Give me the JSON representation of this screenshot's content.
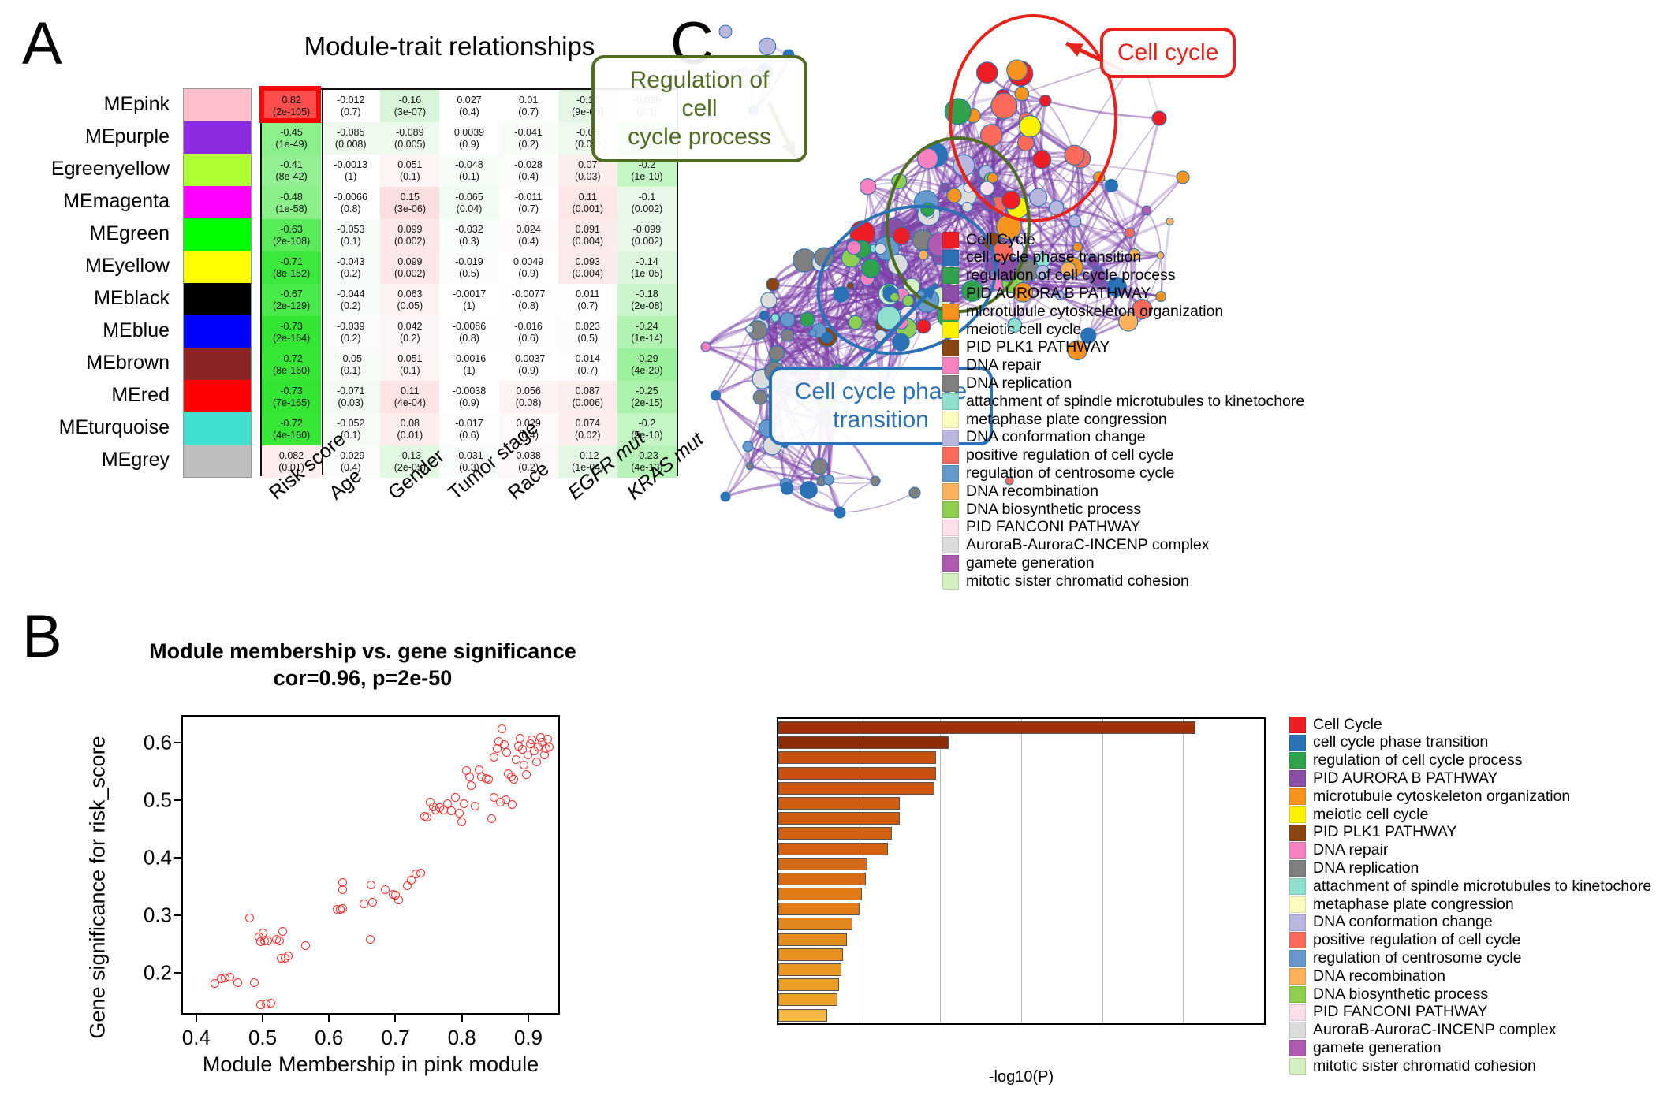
{
  "panels": {
    "a": "A",
    "b": "B",
    "c": "C"
  },
  "heatmap": {
    "title": "Module-trait relationships",
    "row_labels": [
      "MEpink",
      "MEpurple",
      "Egreenyellow",
      "MEmagenta",
      "MEgreen",
      "MEyellow",
      "MEblack",
      "MEblue",
      "MEbrown",
      "MEred",
      "MEturquoise",
      "MEgrey"
    ],
    "row_colors": [
      "#ffc0cb",
      "#8a2be2",
      "#adff2f",
      "#ff00ff",
      "#00ff00",
      "#ffff00",
      "#000000",
      "#0000ff",
      "#8b2525",
      "#ff0000",
      "#40e0d0",
      "#bebebe"
    ],
    "col_labels": [
      "Risk score",
      "Age",
      "Gender",
      "Tumor stage",
      "Race",
      "EGFR mut",
      "KRAS mut"
    ],
    "col_italic": [
      false,
      false,
      false,
      false,
      false,
      true,
      true
    ],
    "highlight_cell": {
      "row": 0,
      "col": 0,
      "color": "#ff0000"
    },
    "cells": [
      [
        {
          "v": "0.82",
          "p": "(2e-105)",
          "bg": "#ff4c4c"
        },
        {
          "v": "-0.012",
          "p": "(0.7)",
          "bg": "#ffffff"
        },
        {
          "v": "-0.16",
          "p": "(3e-07)",
          "bg": "#d9f5d9"
        },
        {
          "v": "0.027",
          "p": "(0.4)",
          "bg": "#ffffff"
        },
        {
          "v": "0.01",
          "p": "(0.7)",
          "bg": "#ffffff"
        },
        {
          "v": "-0.12",
          "p": "(9e-05)",
          "bg": "#e4f7e4"
        },
        {
          "v": "-0.036",
          "p": "(0.3)",
          "bg": "#ffffff"
        }
      ],
      [
        {
          "v": "-0.45",
          "p": "(1e-49)",
          "bg": "#8cf08c"
        },
        {
          "v": "-0.085",
          "p": "(0.008)",
          "bg": "#eefaee"
        },
        {
          "v": "-0.089",
          "p": "(0.005)",
          "bg": "#edfaed"
        },
        {
          "v": "0.0039",
          "p": "(0.9)",
          "bg": "#ffffff"
        },
        {
          "v": "-0.041",
          "p": "(0.2)",
          "bg": "#f7fcf7"
        },
        {
          "v": "-0.08",
          "p": "(0.01)",
          "bg": "#eefaee"
        },
        {
          "v": "-0.29",
          "p": "(2e-20)",
          "bg": "#9cf29c"
        }
      ],
      [
        {
          "v": "-0.41",
          "p": "(8e-42)",
          "bg": "#93f193"
        },
        {
          "v": "-0.0013",
          "p": "(1)",
          "bg": "#ffffff"
        },
        {
          "v": "0.051",
          "p": "(0.1)",
          "bg": "#fdf4f4"
        },
        {
          "v": "-0.048",
          "p": "(0.1)",
          "bg": "#f6fcf6"
        },
        {
          "v": "-0.028",
          "p": "(0.4)",
          "bg": "#fafdfa"
        },
        {
          "v": "0.07",
          "p": "(0.03)",
          "bg": "#fdeeee"
        },
        {
          "v": "-0.2",
          "p": "(1e-10)",
          "bg": "#c4f5c4"
        }
      ],
      [
        {
          "v": "-0.48",
          "p": "(1e-58)",
          "bg": "#8af08a"
        },
        {
          "v": "-0.0066",
          "p": "(0.8)",
          "bg": "#ffffff"
        },
        {
          "v": "0.15",
          "p": "(3e-06)",
          "bg": "#fbdede"
        },
        {
          "v": "-0.065",
          "p": "(0.04)",
          "bg": "#f2fbf2"
        },
        {
          "v": "-0.011",
          "p": "(0.7)",
          "bg": "#fdfefd"
        },
        {
          "v": "0.11",
          "p": "(0.001)",
          "bg": "#fce6e6"
        },
        {
          "v": "-0.1",
          "p": "(0.002)",
          "bg": "#e9f9e9"
        }
      ],
      [
        {
          "v": "-0.63",
          "p": "(2e-108)",
          "bg": "#5aeb5a"
        },
        {
          "v": "-0.053",
          "p": "(0.1)",
          "bg": "#f6fcf6"
        },
        {
          "v": "0.099",
          "p": "(0.002)",
          "bg": "#fce8e8"
        },
        {
          "v": "-0.032",
          "p": "(0.3)",
          "bg": "#f9fdf9"
        },
        {
          "v": "0.024",
          "p": "(0.4)",
          "bg": "#fefafa"
        },
        {
          "v": "0.091",
          "p": "(0.004)",
          "bg": "#fcebeb"
        },
        {
          "v": "-0.099",
          "p": "(0.002)",
          "bg": "#e9f9e9"
        }
      ],
      [
        {
          "v": "-0.71",
          "p": "(8e-152)",
          "bg": "#3ce83c"
        },
        {
          "v": "-0.043",
          "p": "(0.2)",
          "bg": "#f8fcf8"
        },
        {
          "v": "0.099",
          "p": "(0.002)",
          "bg": "#fce8e8"
        },
        {
          "v": "-0.019",
          "p": "(0.5)",
          "bg": "#fbfdfb"
        },
        {
          "v": "0.0049",
          "p": "(0.9)",
          "bg": "#ffffff"
        },
        {
          "v": "0.093",
          "p": "(0.004)",
          "bg": "#fcebeb"
        },
        {
          "v": "-0.14",
          "p": "(1e-05)",
          "bg": "#ddf7dd"
        }
      ],
      [
        {
          "v": "-0.67",
          "p": "(2e-129)",
          "bg": "#4aea4a"
        },
        {
          "v": "-0.044",
          "p": "(0.2)",
          "bg": "#f8fcf8"
        },
        {
          "v": "0.063",
          "p": "(0.05)",
          "bg": "#fdf1f1"
        },
        {
          "v": "-0.0017",
          "p": "(1)",
          "bg": "#ffffff"
        },
        {
          "v": "-0.0077",
          "p": "(0.8)",
          "bg": "#fefefe"
        },
        {
          "v": "0.011",
          "p": "(0.7)",
          "bg": "#fefdfd"
        },
        {
          "v": "-0.18",
          "p": "(2e-08)",
          "bg": "#cdf5cd"
        }
      ],
      [
        {
          "v": "-0.73",
          "p": "(2e-164)",
          "bg": "#33e633"
        },
        {
          "v": "-0.039",
          "p": "(0.2)",
          "bg": "#f9fcf9"
        },
        {
          "v": "0.042",
          "p": "(0.2)",
          "bg": "#fdf6f6"
        },
        {
          "v": "-0.0086",
          "p": "(0.8)",
          "bg": "#fefefe"
        },
        {
          "v": "-0.016",
          "p": "(0.6)",
          "bg": "#fcfdfc"
        },
        {
          "v": "0.023",
          "p": "(0.5)",
          "bg": "#fefbfb"
        },
        {
          "v": "-0.24",
          "p": "(1e-14)",
          "bg": "#b2f3b2"
        }
      ],
      [
        {
          "v": "-0.72",
          "p": "(8e-160)",
          "bg": "#36e736"
        },
        {
          "v": "-0.05",
          "p": "(0.1)",
          "bg": "#f7fcf7"
        },
        {
          "v": "0.051",
          "p": "(0.1)",
          "bg": "#fdf4f4"
        },
        {
          "v": "-0.0016",
          "p": "(1)",
          "bg": "#ffffff"
        },
        {
          "v": "-0.0037",
          "p": "(0.9)",
          "bg": "#ffffff"
        },
        {
          "v": "0.014",
          "p": "(0.7)",
          "bg": "#fefdfd"
        },
        {
          "v": "-0.29",
          "p": "(4e-20)",
          "bg": "#9cf29c"
        }
      ],
      [
        {
          "v": "-0.73",
          "p": "(7e-165)",
          "bg": "#33e633"
        },
        {
          "v": "-0.071",
          "p": "(0.03)",
          "bg": "#f1fbf1"
        },
        {
          "v": "0.11",
          "p": "(4e-04)",
          "bg": "#fce4e4"
        },
        {
          "v": "-0.0038",
          "p": "(0.9)",
          "bg": "#ffffff"
        },
        {
          "v": "0.056",
          "p": "(0.08)",
          "bg": "#fdf3f3"
        },
        {
          "v": "0.087",
          "p": "(0.006)",
          "bg": "#fcecec"
        },
        {
          "v": "-0.25",
          "p": "(2e-15)",
          "bg": "#acf2ac"
        }
      ],
      [
        {
          "v": "-0.72",
          "p": "(4e-160)",
          "bg": "#36e736"
        },
        {
          "v": "-0.052",
          "p": "(0.1)",
          "bg": "#f7fcf7"
        },
        {
          "v": "0.08",
          "p": "(0.01)",
          "bg": "#fdeded"
        },
        {
          "v": "-0.017",
          "p": "(0.6)",
          "bg": "#fcfdfc"
        },
        {
          "v": "0.029",
          "p": "(0.4)",
          "bg": "#fefafa"
        },
        {
          "v": "0.074",
          "p": "(0.02)",
          "bg": "#fdeeee"
        },
        {
          "v": "-0.2",
          "p": "(5e-10)",
          "bg": "#c4f5c4"
        }
      ],
      [
        {
          "v": "0.082",
          "p": "(0.01)",
          "bg": "#fdeded"
        },
        {
          "v": "-0.029",
          "p": "(0.4)",
          "bg": "#fafdfa"
        },
        {
          "v": "-0.13",
          "p": "(2e-05)",
          "bg": "#e1f8e1"
        },
        {
          "v": "-0.031",
          "p": "(0.3)",
          "bg": "#f9fdf9"
        },
        {
          "v": "0.038",
          "p": "(0.2)",
          "bg": "#fdf7f7"
        },
        {
          "v": "-0.12",
          "p": "(1e-04)",
          "bg": "#e4f7e4"
        },
        {
          "v": "-0.23",
          "p": "(4e-13)",
          "bg": "#b6f3b6"
        }
      ]
    ]
  },
  "scatter": {
    "title_line1": "Module membership vs. gene significance",
    "title_line2": "cor=0.96, p=2e-50",
    "xlabel": "Module Membership in pink module",
    "ylabel": "Gene significance for risk_score",
    "xticks": [
      "0.4",
      "0.5",
      "0.6",
      "0.7",
      "0.8",
      "0.9"
    ],
    "yticks": [
      "0.2",
      "0.3",
      "0.4",
      "0.5",
      "0.6"
    ],
    "xlim": [
      0.38,
      0.95
    ],
    "ylim": [
      0.125,
      0.645
    ],
    "point_color": "#ff2a2a",
    "points": [
      [
        0.428,
        0.182
      ],
      [
        0.437,
        0.19
      ],
      [
        0.443,
        0.192
      ],
      [
        0.451,
        0.193
      ],
      [
        0.463,
        0.183
      ],
      [
        0.487,
        0.183
      ],
      [
        0.48,
        0.296
      ],
      [
        0.495,
        0.262
      ],
      [
        0.497,
        0.254
      ],
      [
        0.5,
        0.269
      ],
      [
        0.503,
        0.256
      ],
      [
        0.508,
        0.256
      ],
      [
        0.497,
        0.145
      ],
      [
        0.505,
        0.146
      ],
      [
        0.512,
        0.148
      ],
      [
        0.521,
        0.258
      ],
      [
        0.525,
        0.256
      ],
      [
        0.53,
        0.272
      ],
      [
        0.528,
        0.226
      ],
      [
        0.534,
        0.226
      ],
      [
        0.538,
        0.23
      ],
      [
        0.565,
        0.247
      ],
      [
        0.612,
        0.31
      ],
      [
        0.617,
        0.311
      ],
      [
        0.62,
        0.312
      ],
      [
        0.621,
        0.357
      ],
      [
        0.621,
        0.344
      ],
      [
        0.652,
        0.32
      ],
      [
        0.666,
        0.323
      ],
      [
        0.663,
        0.353
      ],
      [
        0.662,
        0.259
      ],
      [
        0.684,
        0.344
      ],
      [
        0.696,
        0.337
      ],
      [
        0.7,
        0.335
      ],
      [
        0.705,
        0.327
      ],
      [
        0.718,
        0.352
      ],
      [
        0.724,
        0.361
      ],
      [
        0.731,
        0.372
      ],
      [
        0.738,
        0.374
      ],
      [
        0.744,
        0.472
      ],
      [
        0.748,
        0.47
      ],
      [
        0.752,
        0.497
      ],
      [
        0.757,
        0.489
      ],
      [
        0.76,
        0.483
      ],
      [
        0.766,
        0.487
      ],
      [
        0.772,
        0.483
      ],
      [
        0.778,
        0.494
      ],
      [
        0.784,
        0.481
      ],
      [
        0.79,
        0.505
      ],
      [
        0.796,
        0.478
      ],
      [
        0.8,
        0.463
      ],
      [
        0.803,
        0.494
      ],
      [
        0.807,
        0.551
      ],
      [
        0.812,
        0.541
      ],
      [
        0.814,
        0.525
      ],
      [
        0.82,
        0.49
      ],
      [
        0.826,
        0.553
      ],
      [
        0.83,
        0.54
      ],
      [
        0.836,
        0.537
      ],
      [
        0.84,
        0.536
      ],
      [
        0.845,
        0.468
      ],
      [
        0.848,
        0.575
      ],
      [
        0.853,
        0.589
      ],
      [
        0.856,
        0.602
      ],
      [
        0.86,
        0.624
      ],
      [
        0.864,
        0.597
      ],
      [
        0.868,
        0.583
      ],
      [
        0.87,
        0.546
      ],
      [
        0.874,
        0.541
      ],
      [
        0.878,
        0.536
      ],
      [
        0.882,
        0.57
      ],
      [
        0.885,
        0.594
      ],
      [
        0.888,
        0.607
      ],
      [
        0.891,
        0.588
      ],
      [
        0.894,
        0.561
      ],
      [
        0.897,
        0.545
      ],
      [
        0.9,
        0.578
      ],
      [
        0.903,
        0.598
      ],
      [
        0.906,
        0.605
      ],
      [
        0.909,
        0.586
      ],
      [
        0.912,
        0.566
      ],
      [
        0.915,
        0.593
      ],
      [
        0.918,
        0.609
      ],
      [
        0.921,
        0.6
      ],
      [
        0.924,
        0.578
      ],
      [
        0.927,
        0.589
      ],
      [
        0.929,
        0.606
      ],
      [
        0.931,
        0.592
      ],
      [
        0.849,
        0.505
      ],
      [
        0.858,
        0.496
      ],
      [
        0.866,
        0.5
      ],
      [
        0.876,
        0.492
      ]
    ]
  },
  "network": {
    "callouts": {
      "cell_cycle": "Cell cycle",
      "regulation": "Regulation of cell\ncycle process",
      "phase": "Cell cycle phase\ntransition"
    },
    "ellipse_colors": {
      "red": "#e8211a",
      "green": "#4f6d22",
      "blue": "#2a72b5"
    },
    "edge_color": "#7b3fa8",
    "legend": [
      {
        "label": "Cell Cycle",
        "color": "#ee1c25"
      },
      {
        "label": "cell cycle phase transition",
        "color": "#2a72b5"
      },
      {
        "label": "regulation of cell cycle process",
        "color": "#31a24c"
      },
      {
        "label": "PID AURORA B PATHWAY",
        "color": "#8b4fa8"
      },
      {
        "label": "microtubule cytoskeleton organization",
        "color": "#f7941e"
      },
      {
        "label": "meiotic cell cycle",
        "color": "#fff200"
      },
      {
        "label": "PID PLK1 PATHWAY",
        "color": "#8b4513"
      },
      {
        "label": "DNA repair",
        "color": "#f781bf"
      },
      {
        "label": "DNA replication",
        "color": "#808080"
      },
      {
        "label": "attachment of spindle microtubules to kinetochore",
        "color": "#8fe0cf"
      },
      {
        "label": "metaphase plate congression",
        "color": "#fdfdc0"
      },
      {
        "label": "DNA conformation change",
        "color": "#b9b6e0"
      },
      {
        "label": "positive regulation of cell cycle",
        "color": "#fb6a5a"
      },
      {
        "label": "regulation of centrosome cycle",
        "color": "#6699cc"
      },
      {
        "label": "DNA recombination",
        "color": "#fcb25a"
      },
      {
        "label": "DNA biosynthetic process",
        "color": "#8fcf4f"
      },
      {
        "label": "PID FANCONI PATHWAY",
        "color": "#fde0ec"
      },
      {
        "label": "AuroraB-AuroraC-INCENP complex",
        "color": "#dcdcdc"
      },
      {
        "label": "gamete generation",
        "color": "#b05ab0"
      },
      {
        "label": "mitotic sister chromatid cohesion",
        "color": "#d4f0c0"
      }
    ]
  },
  "chart_data": {
    "type": "bar",
    "title": "",
    "xlabel": "-log10(P)",
    "ylabel": "",
    "xlim": [
      0,
      60
    ],
    "xticks": [
      0,
      10,
      20,
      30,
      40,
      50,
      60
    ],
    "grid": true,
    "orientation": "horizontal",
    "categories": [
      "Cell Cycle",
      "cell cycle phase transition",
      "regulation of cell cycle process",
      "PID AURORA B PATHWAY",
      "microtubule cytoskeleton organization",
      "meiotic cell cycle",
      "PID PLK1 PATHWAY",
      "DNA repair",
      "DNA replication",
      "attachment of spindle microtubules to kinetochore",
      "metaphase plate congression",
      "DNA conformation change",
      "positive regulation of cell cycle",
      "regulation of centrosome cycle",
      "DNA recombination",
      "DNA biosynthetic process",
      "PID FANCONI PATHWAY",
      "AuroraB-AuroraC-INCENP complex",
      "gamete generation",
      "mitotic sister chromatid cohesion"
    ],
    "values": [
      51.5,
      21.0,
      19.5,
      19.5,
      19.3,
      15.0,
      15.0,
      14.0,
      13.5,
      11.0,
      10.8,
      10.3,
      10.0,
      9.2,
      8.5,
      8.0,
      7.8,
      7.5,
      7.3,
      6.0
    ],
    "bar_colors": [
      "#a03008",
      "#8f2c08",
      "#c8500f",
      "#c8500f",
      "#cc5510",
      "#d05e12",
      "#d05e12",
      "#d26112",
      "#d26112",
      "#d86b15",
      "#d86b15",
      "#e07b18",
      "#e07b18",
      "#e4861b",
      "#e68b1d",
      "#e8911f",
      "#ea9722",
      "#ec9d24",
      "#ee9f26",
      "#f7b942"
    ],
    "legend": [
      {
        "label": "Cell Cycle",
        "color": "#ee1c25"
      },
      {
        "label": "cell cycle phase transition",
        "color": "#2a72b5"
      },
      {
        "label": "regulation of cell cycle process",
        "color": "#31a24c"
      },
      {
        "label": "PID AURORA B PATHWAY",
        "color": "#8b4fa8"
      },
      {
        "label": "microtubule cytoskeleton organization",
        "color": "#f7941e"
      },
      {
        "label": "meiotic cell cycle",
        "color": "#fff200"
      },
      {
        "label": "PID PLK1 PATHWAY",
        "color": "#8b4513"
      },
      {
        "label": "DNA repair",
        "color": "#f781bf"
      },
      {
        "label": "DNA replication",
        "color": "#808080"
      },
      {
        "label": "attachment of spindle microtubules to kinetochore",
        "color": "#8fe0cf"
      },
      {
        "label": "metaphase plate congression",
        "color": "#fdfdc0"
      },
      {
        "label": "DNA conformation change",
        "color": "#b9b6e0"
      },
      {
        "label": "positive regulation of cell cycle",
        "color": "#fb6a5a"
      },
      {
        "label": "regulation of centrosome cycle",
        "color": "#6699cc"
      },
      {
        "label": "DNA recombination",
        "color": "#fcb25a"
      },
      {
        "label": "DNA biosynthetic process",
        "color": "#8fcf4f"
      },
      {
        "label": "PID FANCONI PATHWAY",
        "color": "#fde0ec"
      },
      {
        "label": "AuroraB-AuroraC-INCENP complex",
        "color": "#dcdcdc"
      },
      {
        "label": "gamete generation",
        "color": "#b05ab0"
      },
      {
        "label": "mitotic sister chromatid cohesion",
        "color": "#d4f0c0"
      }
    ]
  }
}
